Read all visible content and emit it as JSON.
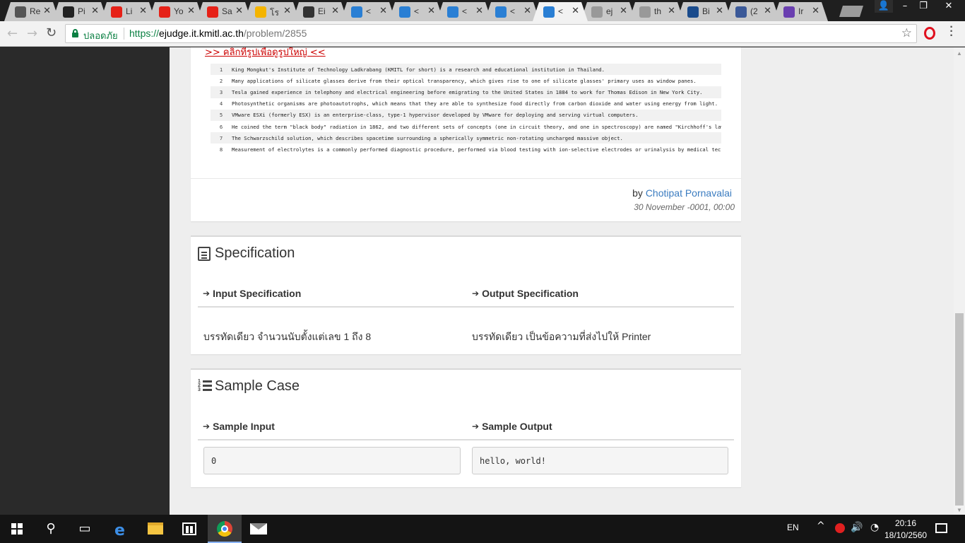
{
  "browser": {
    "tabs": [
      {
        "favicon": "document-icon",
        "favicon_color": "#555555",
        "label": "Re"
      },
      {
        "favicon": "github-icon",
        "favicon_color": "#222222",
        "label": "Pi"
      },
      {
        "favicon": "youtube-icon",
        "favicon_color": "#e62117",
        "label": "Li"
      },
      {
        "favicon": "youtube-icon",
        "favicon_color": "#e62117",
        "label": "Yo"
      },
      {
        "favicon": "youtube-icon",
        "favicon_color": "#e62117",
        "label": "Sa"
      },
      {
        "favicon": "google-drive-icon",
        "favicon_color": "#f4b400",
        "label": "โร"
      },
      {
        "favicon": "character-icon",
        "favicon_color": "#333333",
        "label": "Ei"
      },
      {
        "favicon": "it-kmitl-icon",
        "favicon_color": "#2a7fd4",
        "label": "<"
      },
      {
        "favicon": "it-kmitl-icon",
        "favicon_color": "#2a7fd4",
        "label": "<"
      },
      {
        "favicon": "it-kmitl-icon",
        "favicon_color": "#2a7fd4",
        "label": "<"
      },
      {
        "favicon": "it-kmitl-icon",
        "favicon_color": "#2a7fd4",
        "label": "<"
      },
      {
        "favicon": "it-kmitl-icon",
        "favicon_color": "#2a7fd4",
        "label": "<",
        "active": true
      },
      {
        "favicon": "blank-page-icon",
        "favicon_color": "#999999",
        "label": "ej"
      },
      {
        "favicon": "blank-page-icon",
        "favicon_color": "#999999",
        "label": "th"
      },
      {
        "favicon": "sheet-icon",
        "favicon_color": "#1a4b8c",
        "label": "Bi"
      },
      {
        "favicon": "facebook-icon",
        "favicon_color": "#3b5998",
        "label": "(2"
      },
      {
        "favicon": "list-app-icon",
        "favicon_color": "#6a3fb0",
        "label": "Ir"
      }
    ],
    "security_label": "ปลอดภัย",
    "url_protocol": "https://",
    "url_host": "ejudge.it.kmitl.ac.th",
    "url_path": "/problem/2855"
  },
  "problem": {
    "enlarge_link": ">> คลิกที่รูปเพื่อดูรูปใหญ่ <<",
    "image_lines": [
      {
        "n": "1",
        "text": "King Mongkut's Institute of Technology Ladkrabang (KMITL for short) is a research and educational institution in Thailand."
      },
      {
        "n": "2",
        "text": "Many applications of silicate glasses derive from their optical transparency, which gives rise to one of silicate glasses' primary uses as window panes."
      },
      {
        "n": "3",
        "text": "Tesla gained experience in telephony and electrical engineering before emigrating to the United States in 1884 to work for Thomas Edison in New York City."
      },
      {
        "n": "4",
        "text": "Photosynthetic organisms are photoautotrophs, which means that they are able to synthesize food directly from carbon dioxide and water using energy from light."
      },
      {
        "n": "5",
        "text": "VMware ESXi (formerly ESX) is an enterprise-class, type-1 hypervisor developed by VMware for deploying and serving virtual computers."
      },
      {
        "n": "6",
        "text": "He coined the term \"black body\" radiation in 1862, and two different sets of concepts (one in circuit theory, and one in spectroscopy) are named \"Kirchhoff's laws\"."
      },
      {
        "n": "7",
        "text": "The Schwarzschild solution, which describes spacetime surrounding a spherically symmetric non-rotating uncharged massive object."
      },
      {
        "n": "8",
        "text": "Measurement of electrolytes is a commonly performed diagnostic procedure, performed via blood testing with ion-selective electrodes or urinalysis by medical technologists."
      }
    ],
    "by_label": "by",
    "author": "Chotipat Pornavalai",
    "date": "30 November -0001, 00:00"
  },
  "specification": {
    "title": "Specification",
    "input_heading": "Input Specification",
    "output_heading": "Output Specification",
    "input_text": "บรรทัดเดียว จำนวนนับตั้งแต่เลข 1 ถึง 8",
    "output_text": "บรรทัดเดียว เป็นข้อความที่ส่งไปให้ Printer"
  },
  "sample": {
    "title": "Sample Case",
    "input_heading": "Sample Input",
    "output_heading": "Sample Output",
    "input_value": "0",
    "output_value": "hello, world!"
  },
  "taskbar": {
    "language": "EN",
    "time": "20:16",
    "date": "18/10/2560"
  }
}
